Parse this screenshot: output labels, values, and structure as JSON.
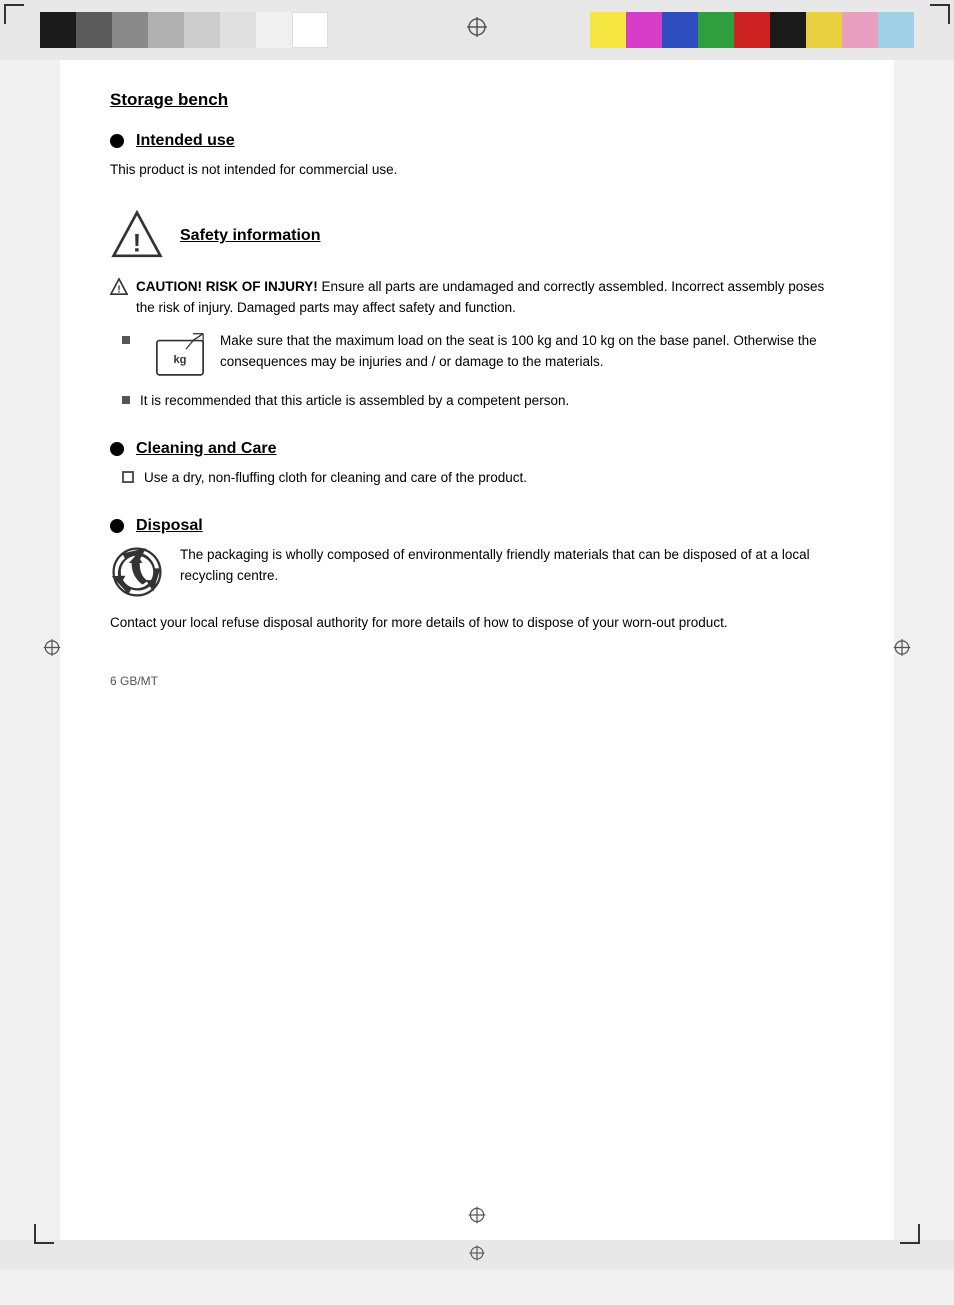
{
  "page": {
    "title": "Storage bench",
    "footer": "6    GB/MT"
  },
  "color_swatches_left": [
    {
      "color": "#1a1a1a",
      "label": "black"
    },
    {
      "color": "#5a5a5a",
      "label": "dark-gray"
    },
    {
      "color": "#8a8a8a",
      "label": "mid-gray"
    },
    {
      "color": "#b0b0b0",
      "label": "light-gray"
    },
    {
      "color": "#cccccc",
      "label": "lighter-gray"
    },
    {
      "color": "#e0e0e0",
      "label": "near-white"
    },
    {
      "color": "#f0f0f0",
      "label": "off-white"
    },
    {
      "color": "#ffffff",
      "label": "white"
    }
  ],
  "color_swatches_right": [
    {
      "color": "#f5e642",
      "label": "yellow"
    },
    {
      "color": "#d63ec8",
      "label": "magenta"
    },
    {
      "color": "#2e4ec0",
      "label": "blue"
    },
    {
      "color": "#2e9e3e",
      "label": "green"
    },
    {
      "color": "#cc2222",
      "label": "red"
    },
    {
      "color": "#1a1a1a",
      "label": "black"
    },
    {
      "color": "#e8d040",
      "label": "yellow2"
    },
    {
      "color": "#e8a0c0",
      "label": "pink"
    },
    {
      "color": "#a0d0e8",
      "label": "light-blue"
    }
  ],
  "sections": {
    "intended_use": {
      "title": "Intended use",
      "body": "This product is not intended for commercial use."
    },
    "safety": {
      "title": "Safety information",
      "caution_label": "CAUTION! RISK OF INJURY!",
      "caution_text": "Ensure all parts are undamaged and correctly assembled. Incorrect assembly poses the risk of injury. Damaged parts may affect safety and function.",
      "bullet1_text": "Make sure that the maximum load on the seat is 100 kg and 10 kg on the base panel. Otherwise the consequences may be injuries and / or damage to the materials.",
      "bullet2_text": "It is recommended that this article is assembled by a competent person."
    },
    "cleaning": {
      "title": "Cleaning and Care",
      "bullet1_text": "Use a dry, non-fluffing cloth for cleaning and care of the product."
    },
    "disposal": {
      "title": "Disposal",
      "recycle_text": "The packaging is wholly composed of environmentally friendly materials that can be disposed of at a local recycling centre.",
      "body": "Contact your local refuse disposal authority for more details of how to dispose of your worn-out product."
    }
  }
}
